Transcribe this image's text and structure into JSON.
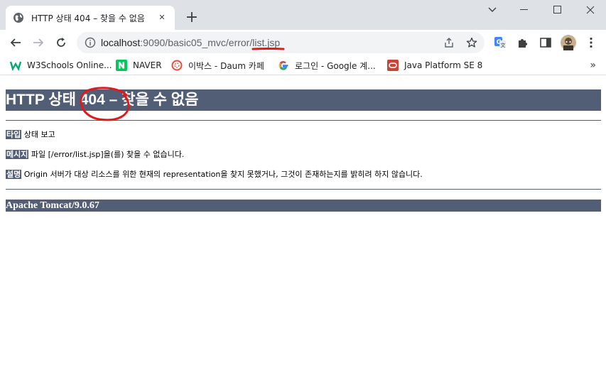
{
  "browser": {
    "tab": {
      "title": "HTTP 상태 404 – 찾을 수 없음",
      "close_glyph": "✕"
    },
    "new_tab_glyph": "+",
    "window_controls": [
      "minimize",
      "maximize",
      "close"
    ],
    "address": {
      "host": "localhost",
      "rest": ":9090/basic05_mvc/error/list.jsp"
    },
    "extensions": [
      "translate-icon",
      "puzzle-icon",
      "sidebar-icon",
      "profile-avatar",
      "menu-icon"
    ],
    "bookmarks": [
      {
        "label": "W3Schools Online...",
        "icon": "w3schools-icon",
        "icon_color": "#04aa6d"
      },
      {
        "label": "NAVER",
        "icon": "naver-icon",
        "icon_color": "#03c75a"
      },
      {
        "label": "이박스 - Daum 카페",
        "icon": "daum-icon",
        "icon_color": "#e94b3c"
      },
      {
        "label": "로그인 - Google 계...",
        "icon": "google-icon",
        "icon_color": "#4285f4"
      },
      {
        "label": "Java Platform SE 8",
        "icon": "oracle-icon",
        "icon_color": "#c74634"
      }
    ],
    "more_bookmarks_glyph": "»"
  },
  "page": {
    "heading": "HTTP 상태 404 – 찾을 수 없음",
    "type": {
      "label": "타입",
      "text": "상태 보고"
    },
    "message": {
      "label": "메시지",
      "text": "파일 [/error/list.jsp]을(를) 찾을 수 없습니다."
    },
    "description": {
      "label": "설명",
      "text": "Origin 서버가 대상 리소스를 위한 현재의 representation을 찾지 못했거나, 그것이 존재하는지를 밝히려 하지 않습니다."
    },
    "footer": "Apache Tomcat/9.0.67"
  },
  "colors": {
    "tomcat_header": "#525d76",
    "annotation_red": "#e01b1b",
    "tabstrip": "#dee1e6"
  }
}
